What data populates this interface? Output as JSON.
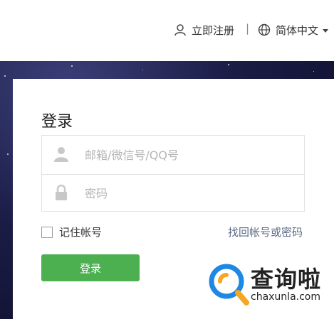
{
  "header": {
    "register_label": "立即注册",
    "separator": "|",
    "language_label": "简体中文"
  },
  "login": {
    "title": "登录",
    "username_placeholder": "邮箱/微信号/QQ号",
    "password_placeholder": "密码",
    "remember_label": "记住帐号",
    "forgot_label": "找回帐号或密码",
    "submit_label": "登录"
  },
  "watermark": {
    "text": "查询啦",
    "url": "chaxunla.com"
  },
  "colors": {
    "primary_button": "#4caf50",
    "link": "#5b6b84",
    "background_dark": "#1a1c45",
    "watermark_accent": "#1e88e5",
    "watermark_orange": "#f5a623"
  }
}
